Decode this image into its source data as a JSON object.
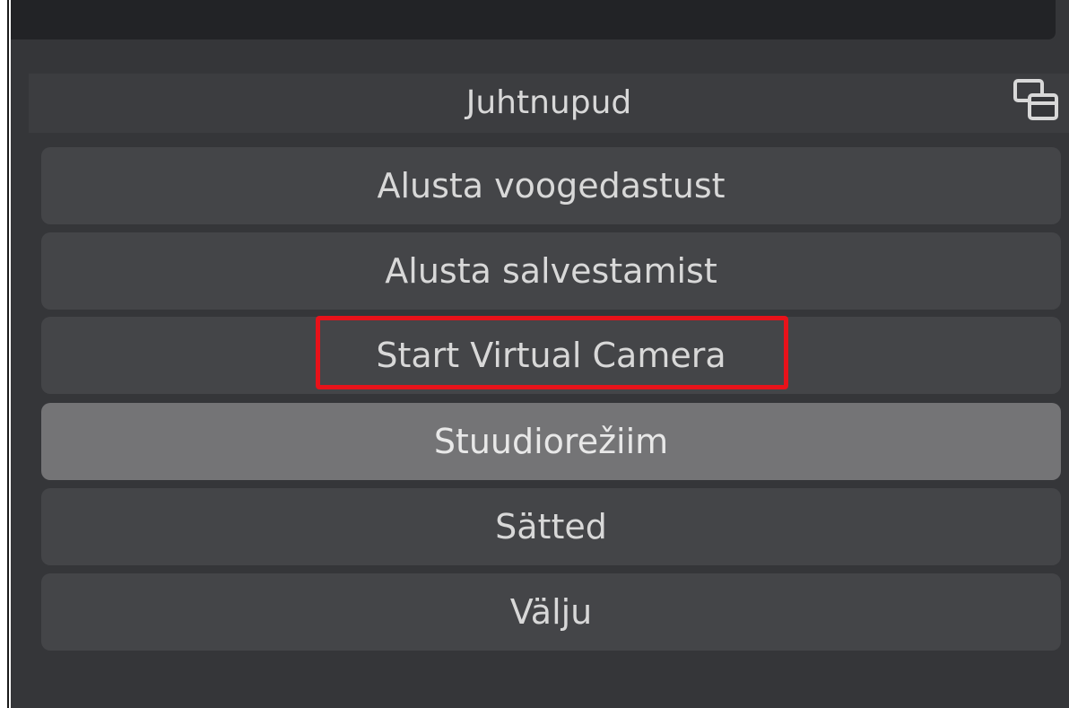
{
  "controls_dock": {
    "title": "Juhtnupud",
    "float_icon": "undock-window-icon",
    "buttons": [
      {
        "label": "Alusta voogedastust"
      },
      {
        "label": "Alusta salvestamist"
      },
      {
        "label": "Start Virtual Camera"
      },
      {
        "label": "Stuudiorežiim"
      },
      {
        "label": "Sätted"
      },
      {
        "label": "Välju"
      }
    ]
  },
  "colors": {
    "panel_bg": "#353639",
    "button_bg": "#444548",
    "button_hover_bg": "#747476",
    "highlight": "#e8121a"
  }
}
